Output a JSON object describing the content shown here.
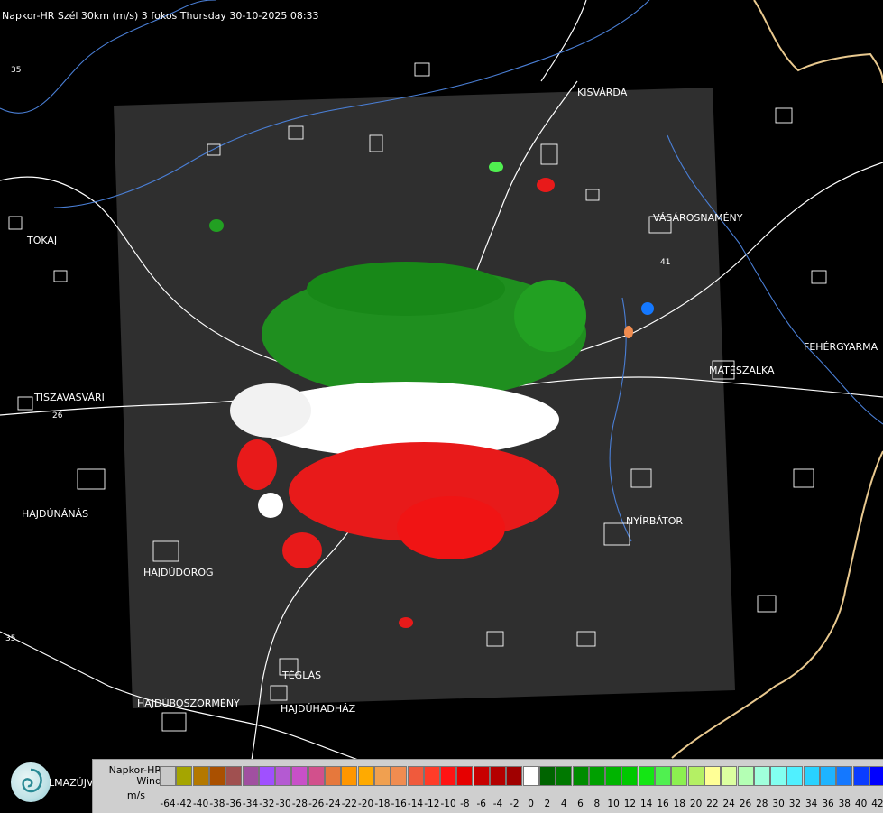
{
  "header": {
    "title": "Napkor-HR Szél 30km (m/s) 3 fokos Thursday 30-10-2025 08:33"
  },
  "cities": [
    {
      "id": "kisvarda",
      "name": "KISVÁRDA"
    },
    {
      "id": "vasarosnameny",
      "name": "VÁSÁROSNAMÉNY"
    },
    {
      "id": "tokaj",
      "name": "TOKAJ"
    },
    {
      "id": "fehergyarmat",
      "name": "FEHÉRGYARMA"
    },
    {
      "id": "mateszalka",
      "name": "MÁTÉSZALKA"
    },
    {
      "id": "tiszavasvari",
      "name": "TISZAVASVÁRI"
    },
    {
      "id": "hajdunanas",
      "name": "HAJDÚNÁNÁS"
    },
    {
      "id": "nyirbator",
      "name": "NYÍRBÁTOR"
    },
    {
      "id": "hajdudorog",
      "name": "HAJDÚDOROG"
    },
    {
      "id": "teglas",
      "name": "TÉGLÁS"
    },
    {
      "id": "hajduboszormeny",
      "name": "HAJDÚBÖSZÖRMÉNY"
    },
    {
      "id": "hajduhadhaz",
      "name": "HAJDÚHADHÁZ"
    },
    {
      "id": "almazujvaros",
      "name": "LMAZÚJVÁR"
    }
  ],
  "road_numbers": [
    "35",
    "26",
    "41",
    "35"
  ],
  "legend": {
    "title_line1": "Napkor-HR",
    "title_line2": "Wind",
    "unit": "m/s",
    "values": [
      -64,
      -42,
      -40,
      -38,
      -36,
      -34,
      -32,
      -30,
      -28,
      -26,
      -24,
      -22,
      -20,
      -18,
      -16,
      -14,
      -12,
      -10,
      -8,
      -6,
      -4,
      -2,
      0,
      2,
      4,
      6,
      8,
      10,
      12,
      14,
      16,
      18,
      20,
      22,
      24,
      26,
      28,
      30,
      32,
      34,
      36,
      38,
      40,
      42
    ],
    "colors": [
      "#c8c8c8",
      "#a5a500",
      "#b47800",
      "#aa5000",
      "#a05050",
      "#a050a0",
      "#a050ff",
      "#b45ad2",
      "#c850c8",
      "#d2508c",
      "#e6783c",
      "#ff9600",
      "#ffaa00",
      "#f0a050",
      "#f08c50",
      "#f05a3c",
      "#ff3c28",
      "#ff1414",
      "#e60000",
      "#c80000",
      "#b40000",
      "#a00000",
      "#ffffff",
      "#006400",
      "#007800",
      "#008c00",
      "#00a000",
      "#00b400",
      "#00c800",
      "#14e614",
      "#50f050",
      "#8cf050",
      "#b4f064",
      "#ffff96",
      "#dcffa0",
      "#b4ffb4",
      "#a0ffdc",
      "#82fff0",
      "#50f0ff",
      "#28d2ff",
      "#1eb4ff",
      "#1478ff",
      "#0a3cff",
      "#0000ff"
    ]
  },
  "brand": {
    "logo_icon": "swirl-logo-icon",
    "radar_bg": "#2f2f2f",
    "green": "#1f8f1f",
    "red": "#e81a1a"
  }
}
